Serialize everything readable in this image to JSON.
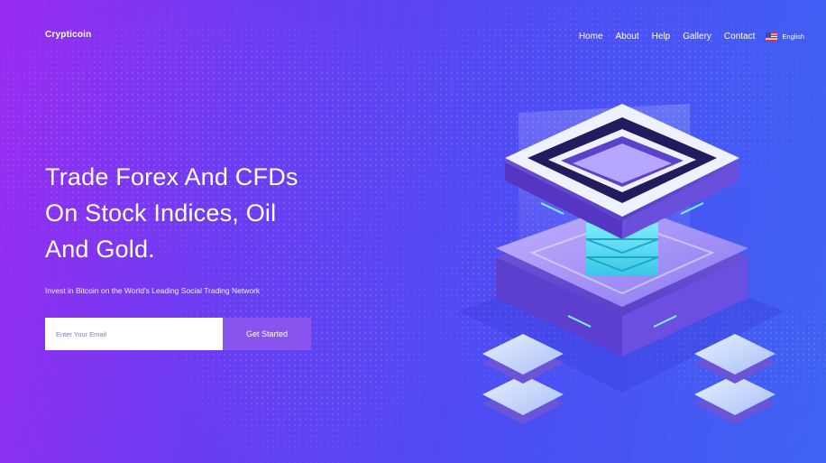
{
  "header": {
    "logo": "Crypticoin",
    "nav": [
      "Home",
      "About",
      "Help",
      "Gallery",
      "Contact"
    ],
    "language": "English"
  },
  "hero": {
    "title_lines": [
      "Trade Forex And CFDs",
      "On Stock Indices, Oil",
      "And Gold."
    ],
    "subtitle": "Invest in Bitcoin on the World's Leading Social Trading Network",
    "email_placeholder": "Enter Your Email",
    "cta_label": "Get Started"
  },
  "colors": {
    "gradient_start": "#9a2cf0",
    "gradient_end": "#3e63f2",
    "button": "#8954ee"
  }
}
